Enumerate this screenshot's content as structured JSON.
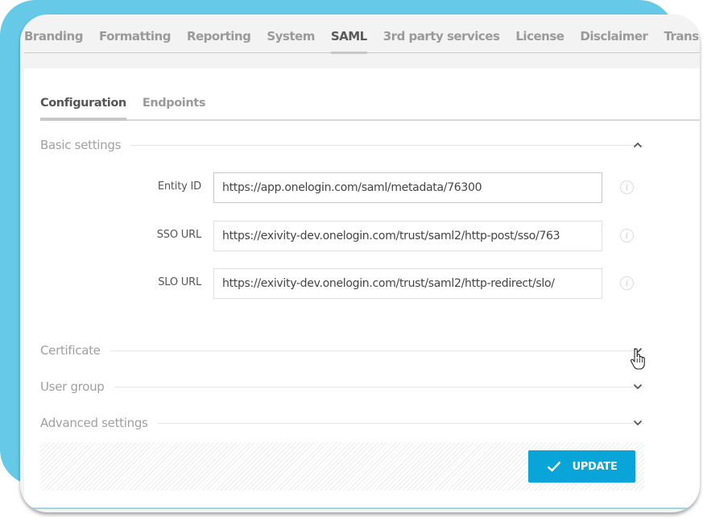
{
  "top_tabs": [
    {
      "label": "Branding",
      "active": false
    },
    {
      "label": "Formatting",
      "active": false
    },
    {
      "label": "Reporting",
      "active": false
    },
    {
      "label": "System",
      "active": false
    },
    {
      "label": "SAML",
      "active": true
    },
    {
      "label": "3rd party services",
      "active": false
    },
    {
      "label": "License",
      "active": false
    },
    {
      "label": "Disclaimer",
      "active": false
    },
    {
      "label": "Translations",
      "active": false
    }
  ],
  "sub_tabs": [
    {
      "label": "Configuration",
      "active": true
    },
    {
      "label": "Endpoints",
      "active": false
    }
  ],
  "sections": {
    "basic": {
      "title": "Basic settings",
      "expanded": true,
      "icon": "chevron-up-icon"
    },
    "certificate": {
      "title": "Certificate",
      "expanded": false,
      "icon": "chevron-down-icon"
    },
    "user_group": {
      "title": "User group",
      "expanded": false,
      "icon": "chevron-down-icon"
    },
    "advanced": {
      "title": "Advanced settings",
      "expanded": false,
      "icon": "chevron-down-icon"
    }
  },
  "fields": {
    "entity_id": {
      "label": "Entity ID",
      "value": "https://app.onelogin.com/saml/metadata/76300",
      "info_icon": "i"
    },
    "sso_url": {
      "label": "SSO URL",
      "value": "https://exivity-dev.onelogin.com/trust/saml2/http-post/sso/763",
      "info_icon": "i"
    },
    "slo_url": {
      "label": "SLO URL",
      "value": "https://exivity-dev.onelogin.com/trust/saml2/http-redirect/slo/",
      "info_icon": "i"
    }
  },
  "actions": {
    "update_label": "UPDATE"
  },
  "colors": {
    "accent": "#0aa5d8",
    "background_blob": "#66c9e8"
  }
}
